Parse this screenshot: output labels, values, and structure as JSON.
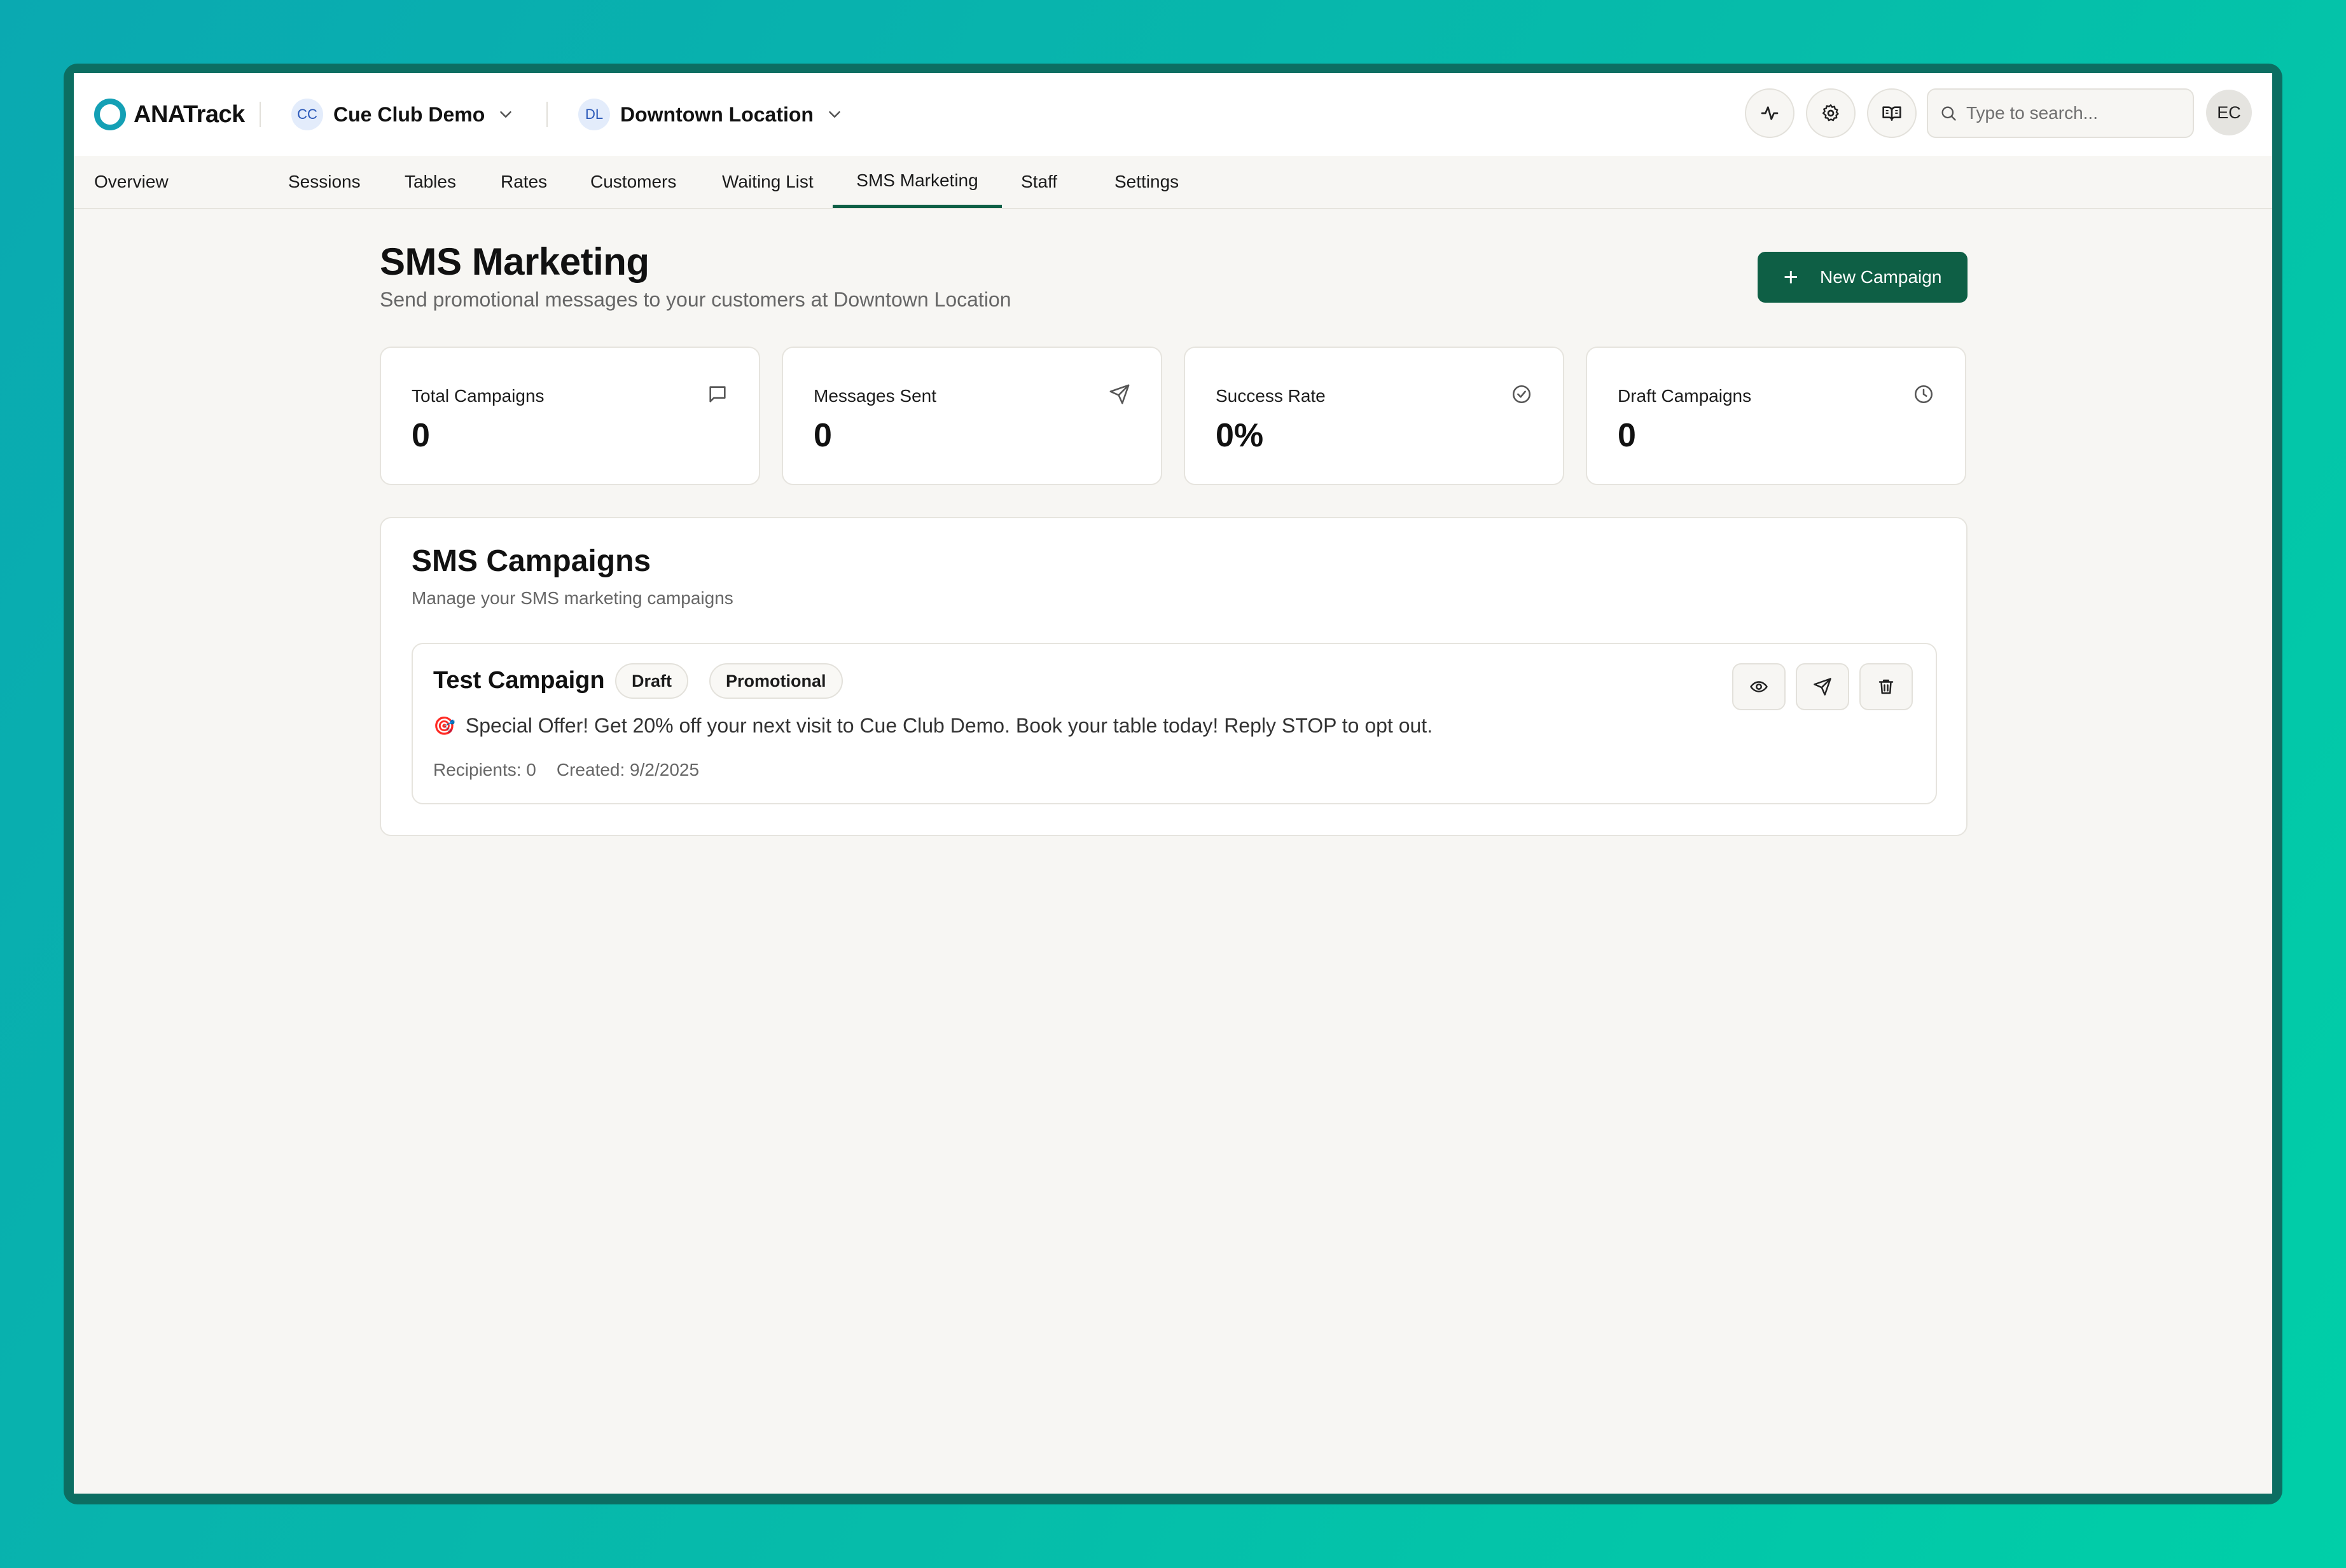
{
  "app": {
    "name": "ANATrack"
  },
  "org_switcher": {
    "initials": "CC",
    "name": "Cue Club Demo"
  },
  "location_switcher": {
    "initials": "DL",
    "name": "Downtown Location"
  },
  "search": {
    "placeholder": "Type to search..."
  },
  "user": {
    "initials": "EC"
  },
  "nav": {
    "tabs": [
      {
        "label": "Overview"
      },
      {
        "label": "Sessions"
      },
      {
        "label": "Tables"
      },
      {
        "label": "Rates"
      },
      {
        "label": "Customers"
      },
      {
        "label": "Waiting List"
      },
      {
        "label": "SMS Marketing",
        "active": true
      },
      {
        "label": "Staff"
      },
      {
        "label": "Settings"
      }
    ]
  },
  "page": {
    "title": "SMS Marketing",
    "subtitle": "Send promotional messages to your customers at Downtown Location",
    "new_campaign_label": "New Campaign"
  },
  "stats": [
    {
      "label": "Total Campaigns",
      "value": "0",
      "icon": "message-square-icon"
    },
    {
      "label": "Messages Sent",
      "value": "0",
      "icon": "send-icon"
    },
    {
      "label": "Success Rate",
      "value": "0%",
      "icon": "check-circle-icon"
    },
    {
      "label": "Draft Campaigns",
      "value": "0",
      "icon": "clock-icon"
    }
  ],
  "campaigns_panel": {
    "title": "SMS Campaigns",
    "subtitle": "Manage your SMS marketing campaigns",
    "campaigns": [
      {
        "name": "Test Campaign",
        "status": "Draft",
        "type": "Promotional",
        "emoji": "🎯",
        "message": "Special Offer! Get 20% off your next visit to Cue Club Demo. Book your table today! Reply STOP to opt out.",
        "recipients": "Recipients: 0",
        "created": "Created: 9/2/2025"
      }
    ]
  },
  "colors": {
    "accent": "#0e5f45",
    "logo": "#14a0b5",
    "background_gradient_start": "#0aa9b1",
    "background_gradient_end": "#00cfa8",
    "frame": "#0c6e62"
  }
}
